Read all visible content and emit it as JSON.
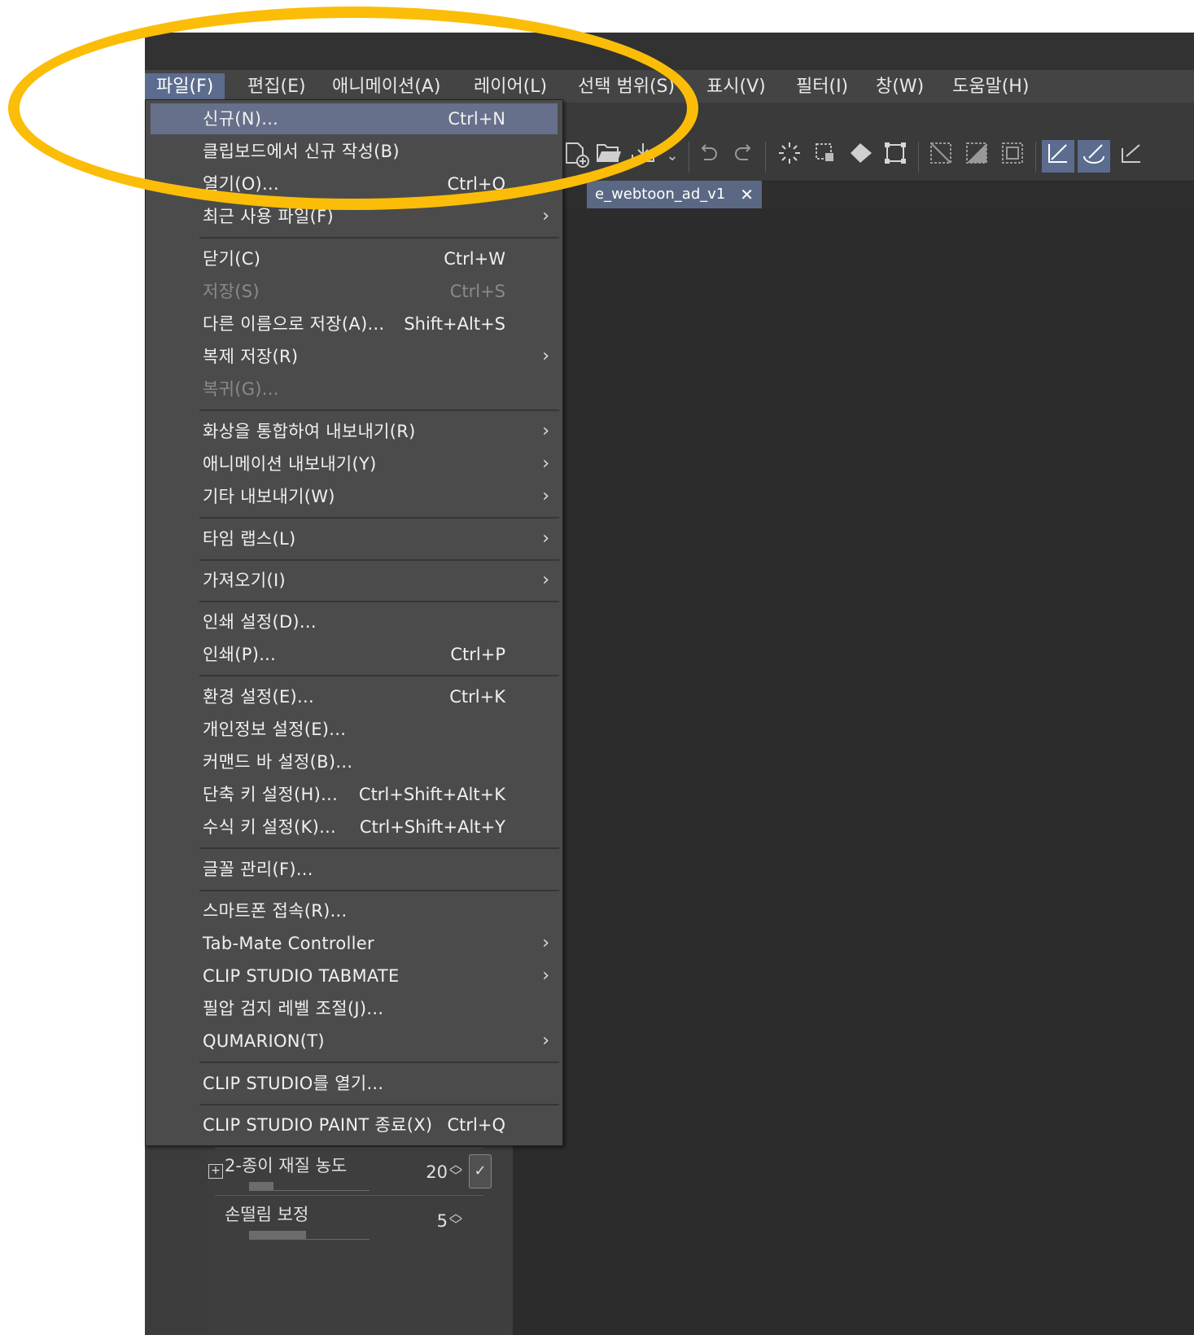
{
  "menubar": {
    "items": [
      {
        "label": "파일(F)",
        "active": true
      },
      {
        "label": "편집(E)"
      },
      {
        "label": "애니메이션(A)"
      },
      {
        "label": "레이어(L)"
      },
      {
        "label": "선택 범위(S)"
      },
      {
        "label": "표시(V)"
      },
      {
        "label": "필터(I)"
      },
      {
        "label": "창(W)"
      },
      {
        "label": "도움말(H)"
      }
    ]
  },
  "document_tab": {
    "title": "e_webtoon_ad_v1",
    "close_glyph": "✕"
  },
  "file_menu": {
    "items": [
      {
        "label": "신규(N)...",
        "shortcut": "Ctrl+N",
        "hover": true
      },
      {
        "label": "클립보드에서 신규 작성(B)",
        "shortcut": ""
      },
      {
        "label": "열기(O)...",
        "shortcut": "Ctrl+O"
      },
      {
        "label": "최근 사용 파일(F)",
        "submenu": true
      },
      {
        "label": "닫기(C)",
        "shortcut": "Ctrl+W"
      },
      {
        "label": "저장(S)",
        "shortcut": "Ctrl+S",
        "disabled": true
      },
      {
        "label": "다른 이름으로 저장(A)...",
        "shortcut": "Shift+Alt+S"
      },
      {
        "label": "복제 저장(R)",
        "submenu": true
      },
      {
        "label": "복귀(G)...",
        "disabled": true
      },
      {
        "label": "화상을 통합하여 내보내기(R)",
        "submenu": true
      },
      {
        "label": "애니메이션 내보내기(Y)",
        "submenu": true
      },
      {
        "label": "기타 내보내기(W)",
        "submenu": true
      },
      {
        "label": "타임 랩스(L)",
        "submenu": true
      },
      {
        "label": "가져오기(I)",
        "submenu": true
      },
      {
        "label": "인쇄 설정(D)..."
      },
      {
        "label": "인쇄(P)...",
        "shortcut": "Ctrl+P"
      },
      {
        "label": "환경 설정(E)...",
        "shortcut": "Ctrl+K"
      },
      {
        "label": "개인정보 설정(E)..."
      },
      {
        "label": "커맨드 바 설정(B)..."
      },
      {
        "label": "단축 키 설정(H)...",
        "shortcut": "Ctrl+Shift+Alt+K"
      },
      {
        "label": "수식 키 설정(K)...",
        "shortcut": "Ctrl+Shift+Alt+Y"
      },
      {
        "label": "글꼴 관리(F)..."
      },
      {
        "label": "스마트폰 접속(R)..."
      },
      {
        "label": "Tab-Mate Controller",
        "submenu": true
      },
      {
        "label": "CLIP STUDIO TABMATE",
        "submenu": true
      },
      {
        "label": "필압 검지 레벨 조절(J)..."
      },
      {
        "label": "QUMARION(T)",
        "submenu": true
      },
      {
        "label": "CLIP STUDIO를 열기..."
      },
      {
        "label": "CLIP STUDIO PAINT 종료(X)",
        "shortcut": "Ctrl+Q"
      }
    ],
    "arrow_glyph": "›"
  },
  "tool_properties": [
    {
      "label": "2-종이 재질 농도",
      "value": "20",
      "fill": 0.2,
      "expandable": true,
      "checkbox": true
    },
    {
      "label": "손떨림 보정",
      "value": "5",
      "fill": 0.47
    }
  ],
  "icons": {
    "new": "new-canvas-icon",
    "open": "open-folder-icon",
    "save": "save-icon",
    "undo": "undo-icon",
    "redo": "redo-icon"
  },
  "colors": {
    "highlight": "#fbbd08",
    "menu_hover": "#67708a",
    "menubar_active": "#5c6c8e"
  }
}
